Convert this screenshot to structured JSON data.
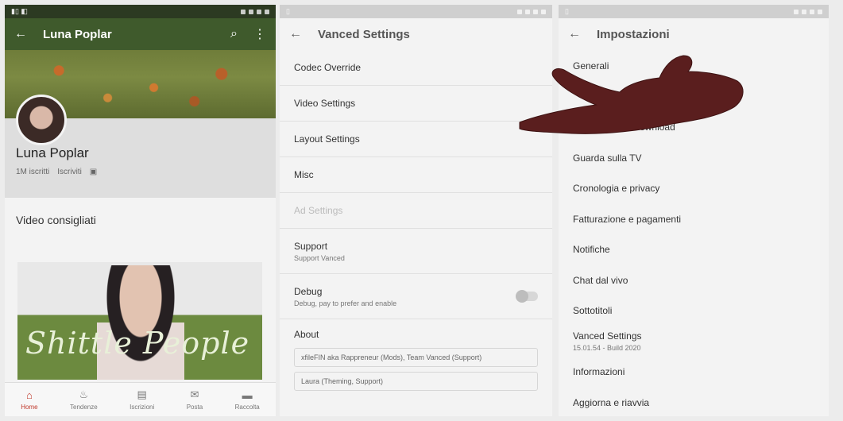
{
  "panel_channel": {
    "title": "Luna Poplar",
    "banner_alt": "banner",
    "channel_name": "Luna Poplar",
    "channel_meta": [
      "1M iscritti",
      "Iscriviti"
    ],
    "section_title": "Video consigliati",
    "thumb_caption": "Shittle People",
    "bottom_nav": [
      {
        "label": "Home",
        "icon": "home-icon"
      },
      {
        "label": "Tendenze",
        "icon": "trending-icon"
      },
      {
        "label": "Iscrizioni",
        "icon": "subscriptions-icon"
      },
      {
        "label": "Posta",
        "icon": "inbox-icon"
      },
      {
        "label": "Raccolta",
        "icon": "library-icon"
      }
    ]
  },
  "panel_vanced": {
    "title": "Vanced Settings",
    "items": [
      {
        "label": "Codec Override"
      },
      {
        "label": "Video Settings"
      },
      {
        "label": "Layout Settings"
      },
      {
        "label": "Misc"
      },
      {
        "label": "Ad Settings",
        "disabled": true
      }
    ],
    "support": {
      "label": "Support",
      "sub": "Support Vanced"
    },
    "debug": {
      "label": "Debug",
      "sub": "Debug, pay to prefer and enable"
    },
    "about_label": "About",
    "chips": [
      "xfileFIN aka Rappreneur (Mods), Team Vanced (Support)",
      "Laura (Theming, Support)"
    ]
  },
  "panel_impostazioni": {
    "title": "Impostazioni",
    "items": [
      {
        "label": "Generali"
      },
      {
        "label": ""
      },
      {
        "label": "Background e download"
      },
      {
        "label": "Guarda sulla TV"
      },
      {
        "label": "Cronologia e privacy"
      },
      {
        "label": "Fatturazione e pagamenti"
      },
      {
        "label": "Notifiche"
      },
      {
        "label": "Chat dal vivo"
      },
      {
        "label": "Sottotitoli"
      },
      {
        "label": "Vanced Settings",
        "sub": "15.01.54 - Build 2020"
      },
      {
        "label": "Informazioni"
      },
      {
        "label": "Aggiorna e riavvia"
      }
    ]
  },
  "colors": {
    "channel_bar": "#3f5a2c",
    "panel_bg": "#f3f3f3",
    "hand": "#5a1e1e"
  }
}
